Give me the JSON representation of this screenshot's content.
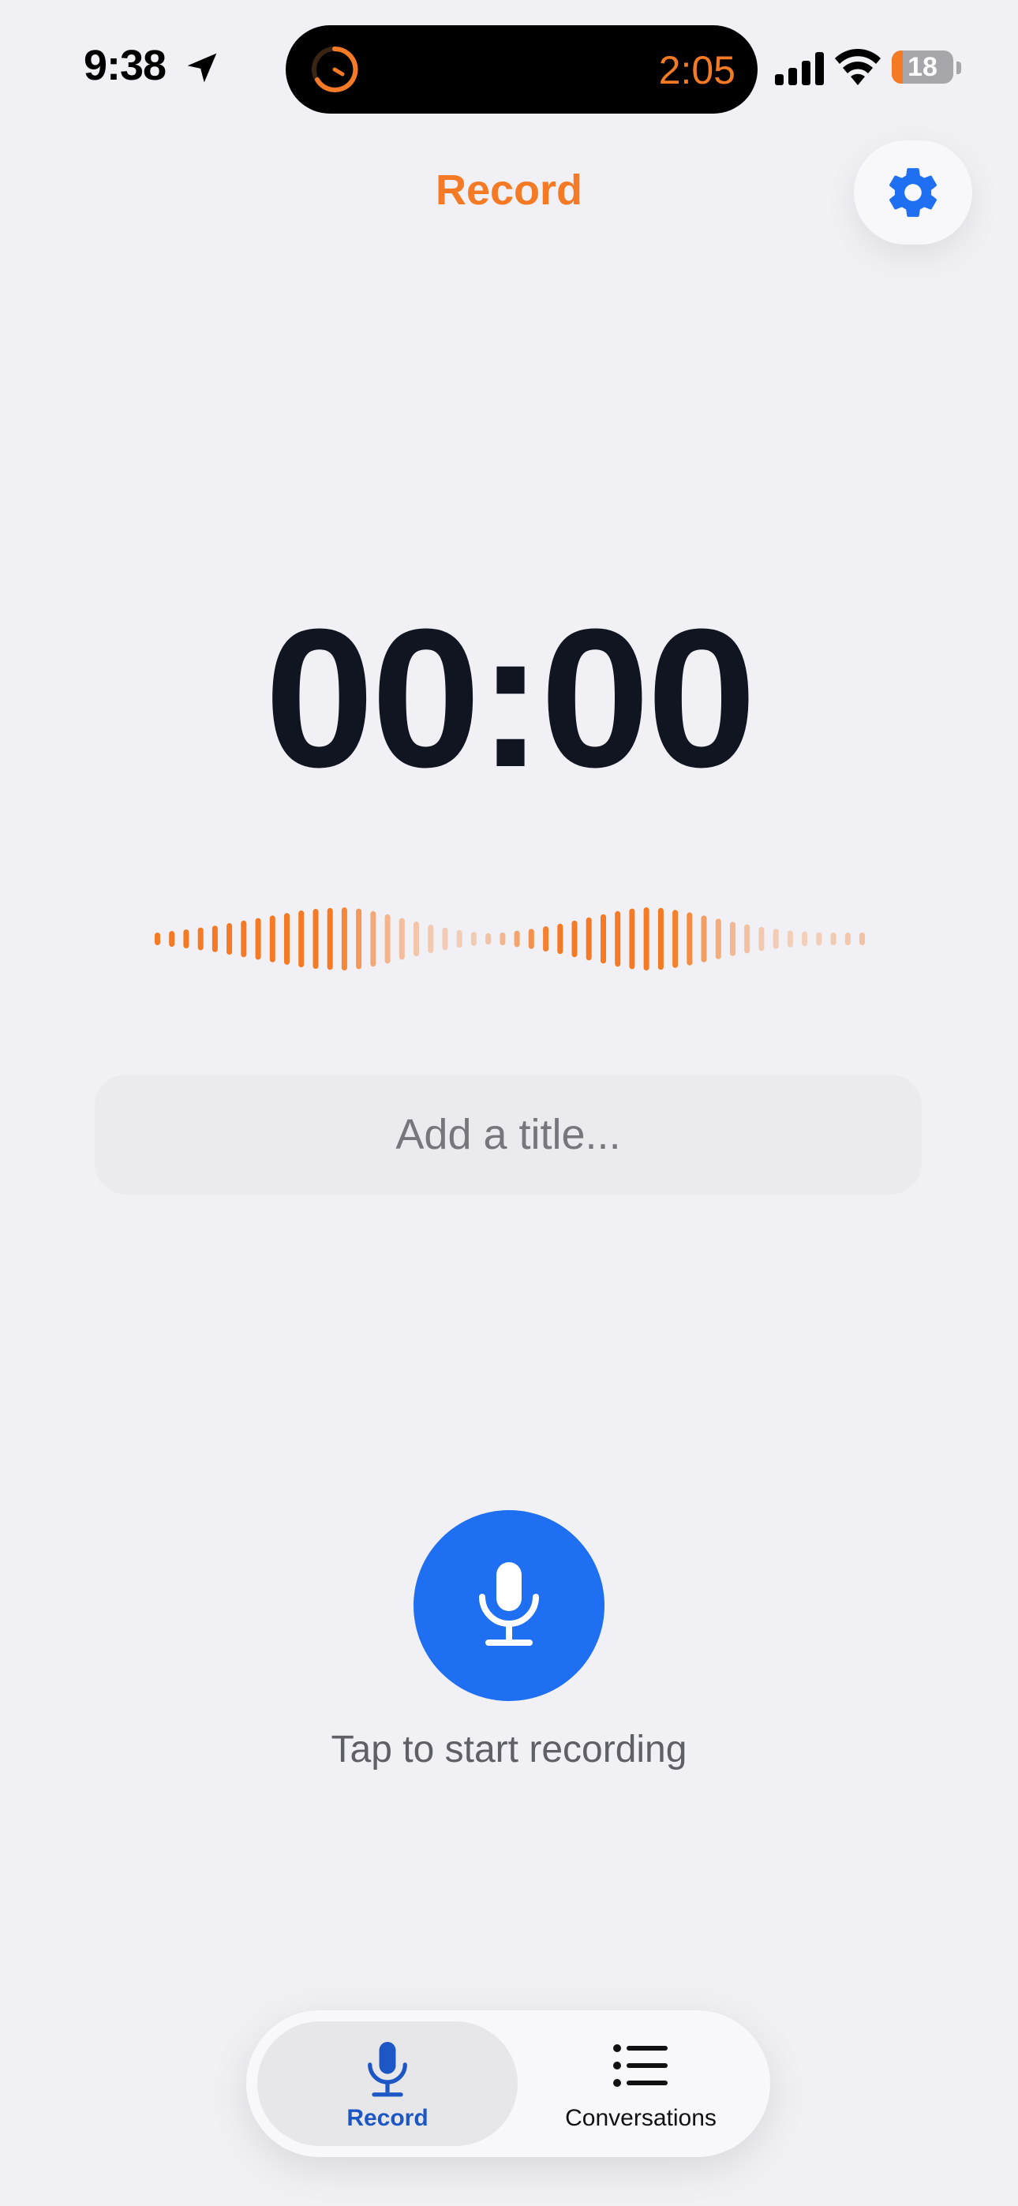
{
  "status_bar": {
    "time": "9:38",
    "island_timer": "2:05",
    "battery_level": "18",
    "battery_fraction": 0.18
  },
  "header": {
    "title": "Record",
    "settings_icon": "gear-icon"
  },
  "timer": {
    "display": "00:00"
  },
  "waveform": {
    "bar_count": 50,
    "heights": [
      0.2,
      0.25,
      0.3,
      0.36,
      0.42,
      0.5,
      0.58,
      0.66,
      0.74,
      0.82,
      0.9,
      0.95,
      0.98,
      1.0,
      0.96,
      0.88,
      0.78,
      0.66,
      0.55,
      0.45,
      0.36,
      0.28,
      0.22,
      0.18,
      0.2,
      0.26,
      0.32,
      0.4,
      0.48,
      0.58,
      0.68,
      0.78,
      0.88,
      0.96,
      1.0,
      0.98,
      0.92,
      0.84,
      0.74,
      0.64,
      0.54,
      0.46,
      0.38,
      0.32,
      0.27,
      0.23,
      0.21,
      0.2,
      0.2,
      0.2
    ],
    "opacity": [
      1,
      1,
      1,
      1,
      1,
      1,
      1,
      1,
      1,
      1,
      1,
      1,
      1,
      0.9,
      0.75,
      0.6,
      0.5,
      0.42,
      0.36,
      0.32,
      0.3,
      0.3,
      0.32,
      0.38,
      0.5,
      0.65,
      0.8,
      0.95,
      1,
      1,
      1,
      1,
      1,
      1,
      1,
      1,
      0.95,
      0.85,
      0.7,
      0.58,
      0.48,
      0.4,
      0.34,
      0.3,
      0.28,
      0.28,
      0.3,
      0.32,
      0.35,
      0.4
    ]
  },
  "title_input": {
    "placeholder": "Add a title...",
    "value": ""
  },
  "record": {
    "hint": "Tap to start recording",
    "icon": "microphone-icon"
  },
  "tabs": [
    {
      "label": "Record",
      "icon": "microphone-icon",
      "selected": true
    },
    {
      "label": "Conversations",
      "icon": "list-icon",
      "selected": false
    }
  ],
  "colors": {
    "accent_orange": "#f47a25",
    "primary_blue": "#1f6ff2",
    "selected_tab_text": "#1d57c6",
    "background": "#f1f0f5",
    "timer_text": "#111521"
  }
}
